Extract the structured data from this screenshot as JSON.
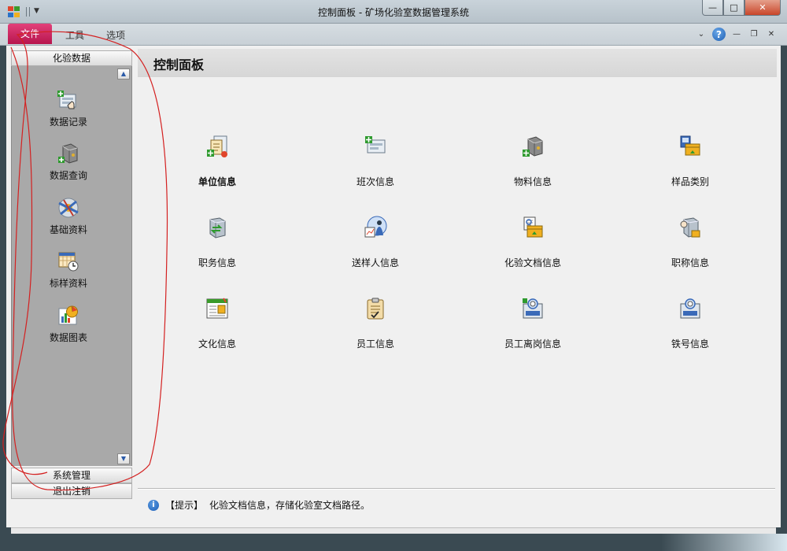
{
  "window": {
    "title": "控制面板 - 矿场化验室数据管理系统",
    "minimize": "—",
    "maximize": "□",
    "close": "✕"
  },
  "ribbon": {
    "tabs": [
      "文件",
      "工具",
      "选项"
    ],
    "active_tab": "文件",
    "help": "?"
  },
  "sidebar": {
    "groups": [
      "化验数据",
      "系统管理",
      "退出注销"
    ],
    "items": [
      {
        "label": "数据记录",
        "icon": "data-record-icon"
      },
      {
        "label": "数据查询",
        "icon": "data-query-icon"
      },
      {
        "label": "基础资料",
        "icon": "base-data-icon"
      },
      {
        "label": "标样资料",
        "icon": "standard-sample-icon"
      },
      {
        "label": "数据图表",
        "icon": "data-chart-icon"
      }
    ]
  },
  "panel": {
    "title": "控制面板",
    "items": [
      {
        "label": "单位信息",
        "icon": "unit-info-icon"
      },
      {
        "label": "班次信息",
        "icon": "shift-info-icon"
      },
      {
        "label": "物料信息",
        "icon": "material-info-icon"
      },
      {
        "label": "样品类别",
        "icon": "sample-category-icon"
      },
      {
        "label": "职务信息",
        "icon": "position-info-icon"
      },
      {
        "label": "送样人信息",
        "icon": "sampler-info-icon"
      },
      {
        "label": "化验文档信息",
        "icon": "lab-document-icon"
      },
      {
        "label": "职称信息",
        "icon": "title-info-icon"
      },
      {
        "label": "文化信息",
        "icon": "education-info-icon"
      },
      {
        "label": "员工信息",
        "icon": "employee-info-icon"
      },
      {
        "label": "员工离岗信息",
        "icon": "employee-leave-icon"
      },
      {
        "label": "铁号信息",
        "icon": "iron-number-icon"
      }
    ]
  },
  "hint": {
    "prefix": "【提示】",
    "text": "化验文档信息，存储化验室文档路径。"
  },
  "colors": {
    "file_tab": "#c51a55",
    "sidebar_body": "#a9a9a9",
    "annotation": "#d42020"
  }
}
